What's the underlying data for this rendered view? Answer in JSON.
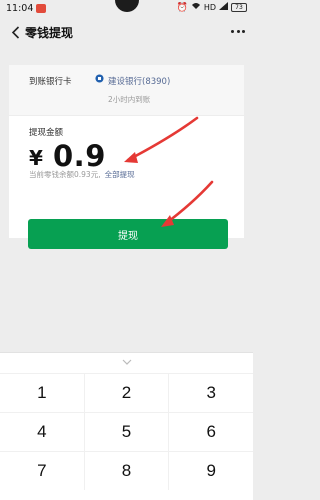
{
  "status_bar": {
    "time": "11:04",
    "network_label": "HD",
    "battery": "73"
  },
  "header": {
    "back_icon": "chevron-left-icon",
    "title": "零钱提现",
    "more_icon": "more-dots-icon"
  },
  "bank": {
    "label": "到账银行卡",
    "logo_icon": "ccb-bank-logo-icon",
    "name": "建设银行(8390)",
    "arrival_time": "2小时内到账"
  },
  "amount": {
    "label": "提现金额",
    "currency": "¥",
    "value": "0.9",
    "balance_text": "当前零钱余额0.93元,",
    "withdraw_all": "全部提现",
    "submit_label": "提现"
  },
  "keypad": {
    "collapse_icon": "chevron-down-icon",
    "rows": [
      [
        "1",
        "2",
        "3"
      ],
      [
        "4",
        "5",
        "6"
      ],
      [
        "7",
        "8",
        "9"
      ]
    ]
  },
  "colors": {
    "accent_green": "#07a052",
    "link_blue": "#576b95",
    "annotation_red": "#e53935"
  }
}
